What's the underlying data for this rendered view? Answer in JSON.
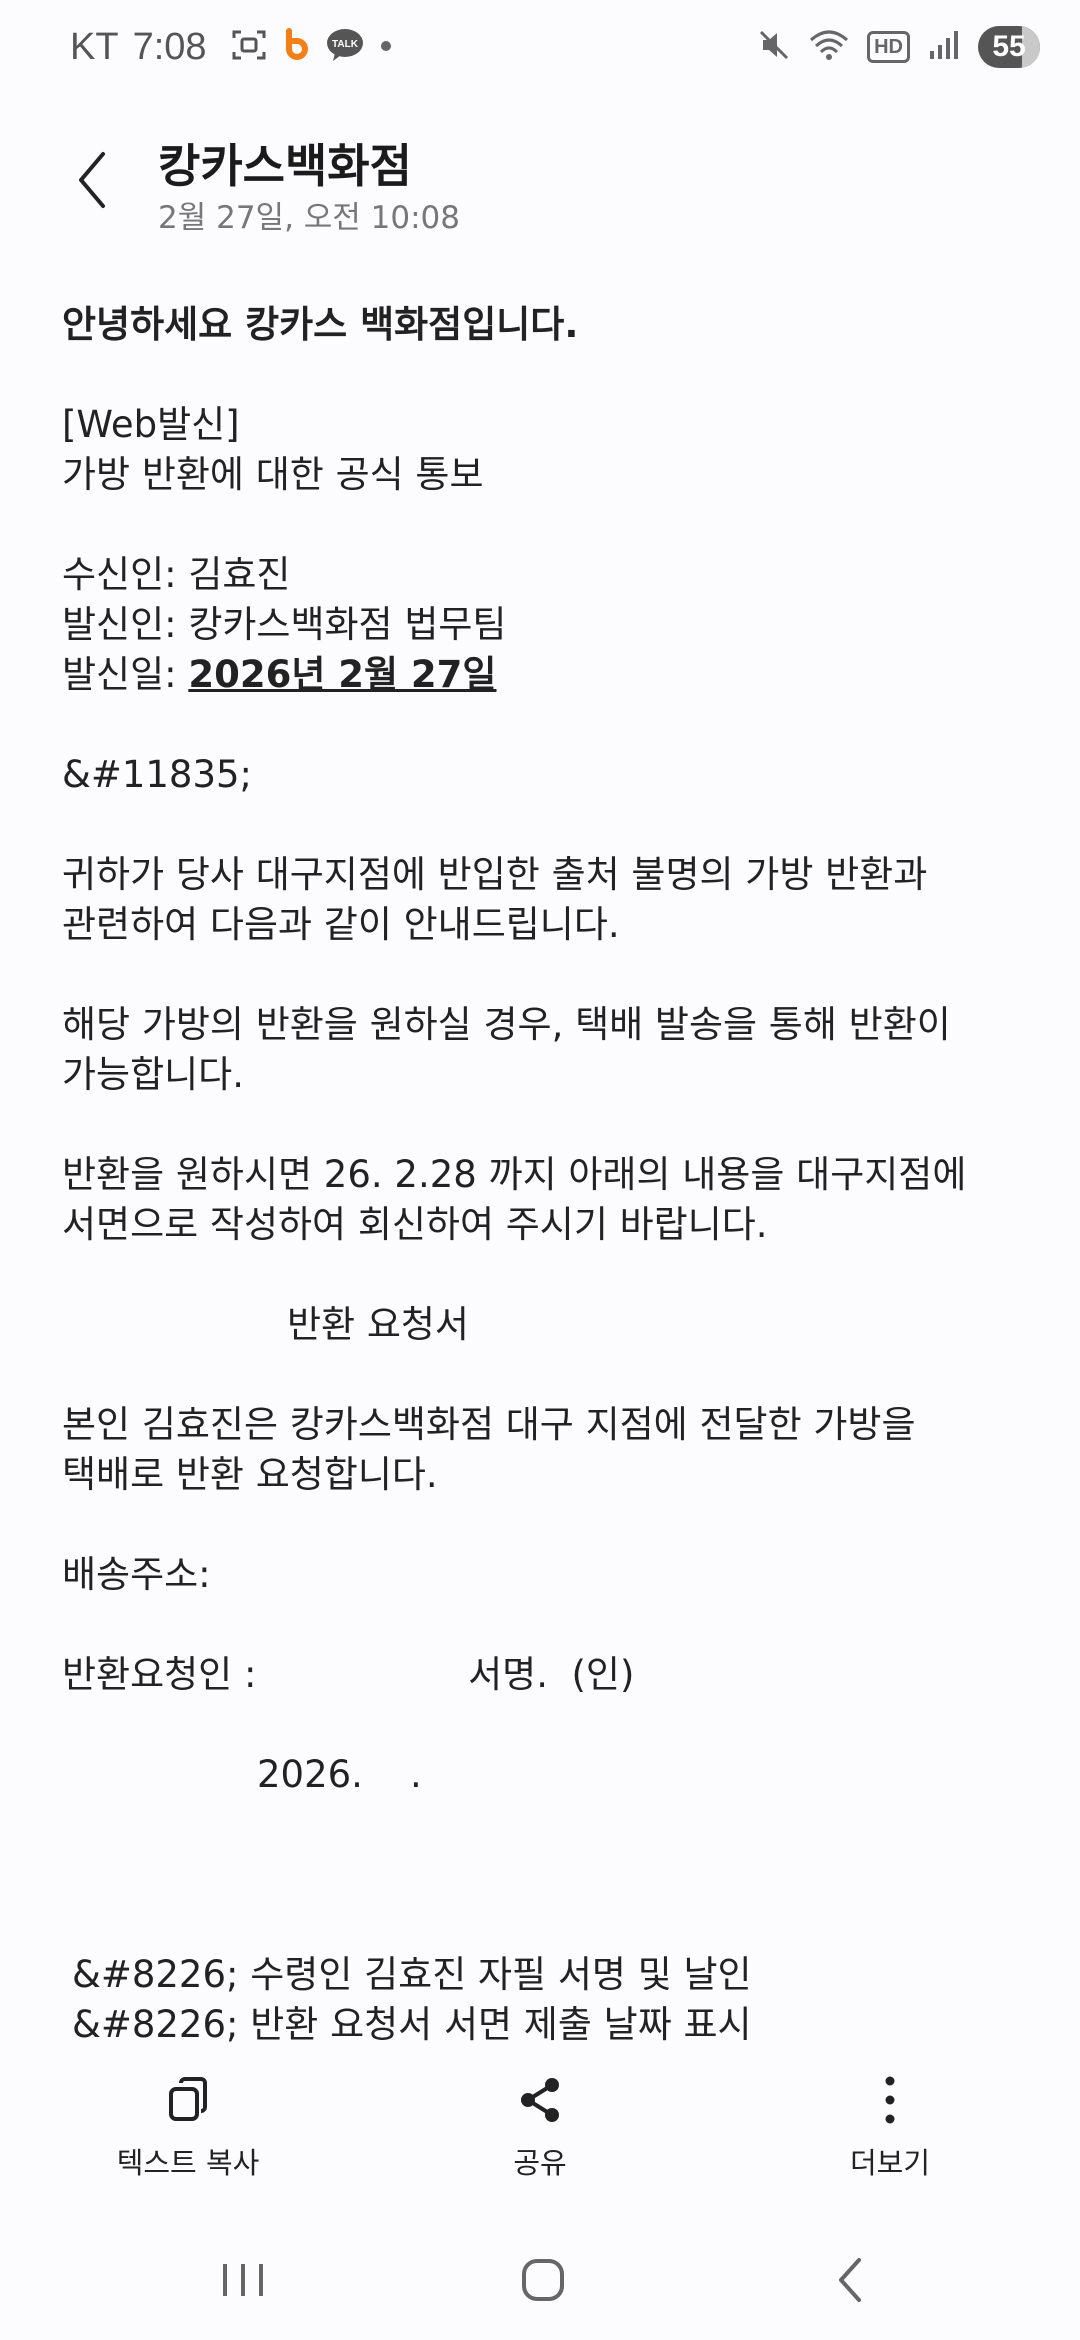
{
  "status_bar": {
    "carrier": "KT",
    "time": "7:08",
    "icons_left": [
      "screenshot-icon",
      "notification-app-icon",
      "kakaotalk-icon",
      "dot-icon"
    ],
    "kakao_label": "TALK",
    "icons_right": [
      "mute-icon",
      "wifi-icon",
      "hd-icon",
      "signal-icon"
    ],
    "hd_label": "HD",
    "battery": "55"
  },
  "header": {
    "title": "캉카스백화점",
    "subtitle": "2월 27일, 오전 10:08"
  },
  "message": {
    "greeting": "안녕하세요 캉카스 백화점입니다.",
    "web_tag": "[Web발신]",
    "subject": "가방 반환에 대한 공식 통보",
    "recipient": "수신인: 김효진",
    "sender": "발신인: 캉카스백화점 법무팀",
    "date_label": "발신일: ",
    "date_value": "2026년 2월 27일",
    "entity": "&#11835;",
    "para1_line1": "귀하가 당사 대구지점에 반입한 출처 불명의 가방 반환과",
    "para1_line2": "관련하여 다음과 같이 안내드립니다.",
    "para2_line1": "해당 가방의 반환을 원하실 경우, 택배 발송을 통해 반환이",
    "para2_line2": "가능합니다.",
    "para3_line1": "반환을 원하시면 26. 2.28 까지 아래의 내용을 대구지점에",
    "para3_line2": "서면으로 작성하여 회신하여 주시기 바랍니다.",
    "form_title": "반환 요청서",
    "form_line1": "본인 김효진은 캉카스백화점 대구 지점에 전달한 가방을",
    "form_line2": "택배로 반환 요청합니다.",
    "address": "배송주소:",
    "requester": "반환요청인 :                  서명.  (인)",
    "form_date": "2026.    .",
    "note1": "&#8226; 수령인 김효진 자필 서명 및 날인",
    "note2": "&#8226; 반환 요청서 서면 제출 날짜 표시"
  },
  "actions": {
    "copy_label": "텍스트 복사",
    "share_label": "공유",
    "more_label": "더보기"
  },
  "colors": {
    "background": "#fcfbfe",
    "text": "#222222",
    "subtle": "#777777",
    "kakao_yellow": "#3a1d1d",
    "notif_orange": "#f57f17"
  }
}
